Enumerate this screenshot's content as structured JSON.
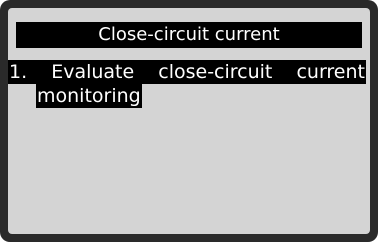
{
  "header": {
    "title": "Close-circuit current"
  },
  "menu": {
    "items": [
      {
        "line1": "1. Evaluate close-circuit current",
        "line2": "monitoring",
        "selected": true
      }
    ]
  },
  "colors": {
    "screen_bg": "#d4d4d4",
    "highlight_bg": "#000000",
    "highlight_text": "#ffffff",
    "bezel": "#2a2a2a"
  }
}
